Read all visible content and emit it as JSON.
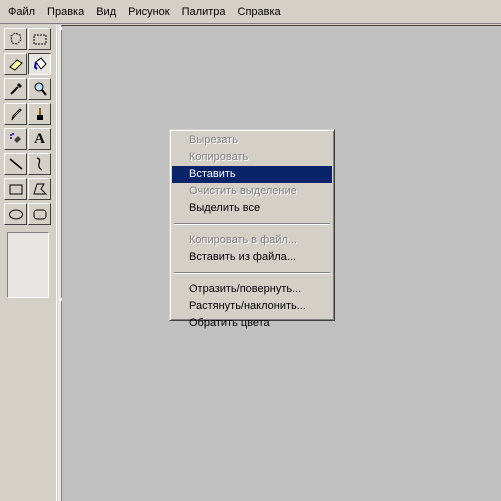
{
  "menubar": {
    "items": [
      "Файл",
      "Правка",
      "Вид",
      "Рисунок",
      "Палитра",
      "Справка"
    ]
  },
  "toolbox": {
    "tools": [
      {
        "icon": "free-select-icon"
      },
      {
        "icon": "rect-select-icon"
      },
      {
        "icon": "eraser-icon"
      },
      {
        "icon": "fill-icon"
      },
      {
        "icon": "color-picker-icon"
      },
      {
        "icon": "magnifier-icon"
      },
      {
        "icon": "pencil-icon"
      },
      {
        "icon": "brush-icon"
      },
      {
        "icon": "airbrush-icon"
      },
      {
        "icon": "text-icon",
        "glyph": "A"
      },
      {
        "icon": "line-icon"
      },
      {
        "icon": "curve-icon"
      },
      {
        "icon": "rectangle-icon"
      },
      {
        "icon": "polygon-icon"
      },
      {
        "icon": "ellipse-icon"
      },
      {
        "icon": "rounded-rect-icon"
      }
    ],
    "active_tool": "fill-icon"
  },
  "context_menu": {
    "groups": [
      [
        {
          "label": "Вырезать",
          "state": "disabled"
        },
        {
          "label": "Копировать",
          "state": "disabled"
        },
        {
          "label": "Вставить",
          "state": "selected"
        },
        {
          "label": "Очистить выделение",
          "state": "disabled"
        },
        {
          "label": "Выделить все",
          "state": "enabled"
        }
      ],
      [
        {
          "label": "Копировать в файл...",
          "state": "disabled"
        },
        {
          "label": "Вставить из файла...",
          "state": "enabled"
        }
      ],
      [
        {
          "label": "Отразить/повернуть...",
          "state": "enabled"
        },
        {
          "label": "Растянуть/наклонить...",
          "state": "enabled"
        },
        {
          "label": "Обратить цвета",
          "state": "enabled"
        }
      ]
    ]
  },
  "colors": {
    "selection": "#0a246a",
    "face": "#d4d0c8",
    "workspace": "#c0c0c0"
  }
}
